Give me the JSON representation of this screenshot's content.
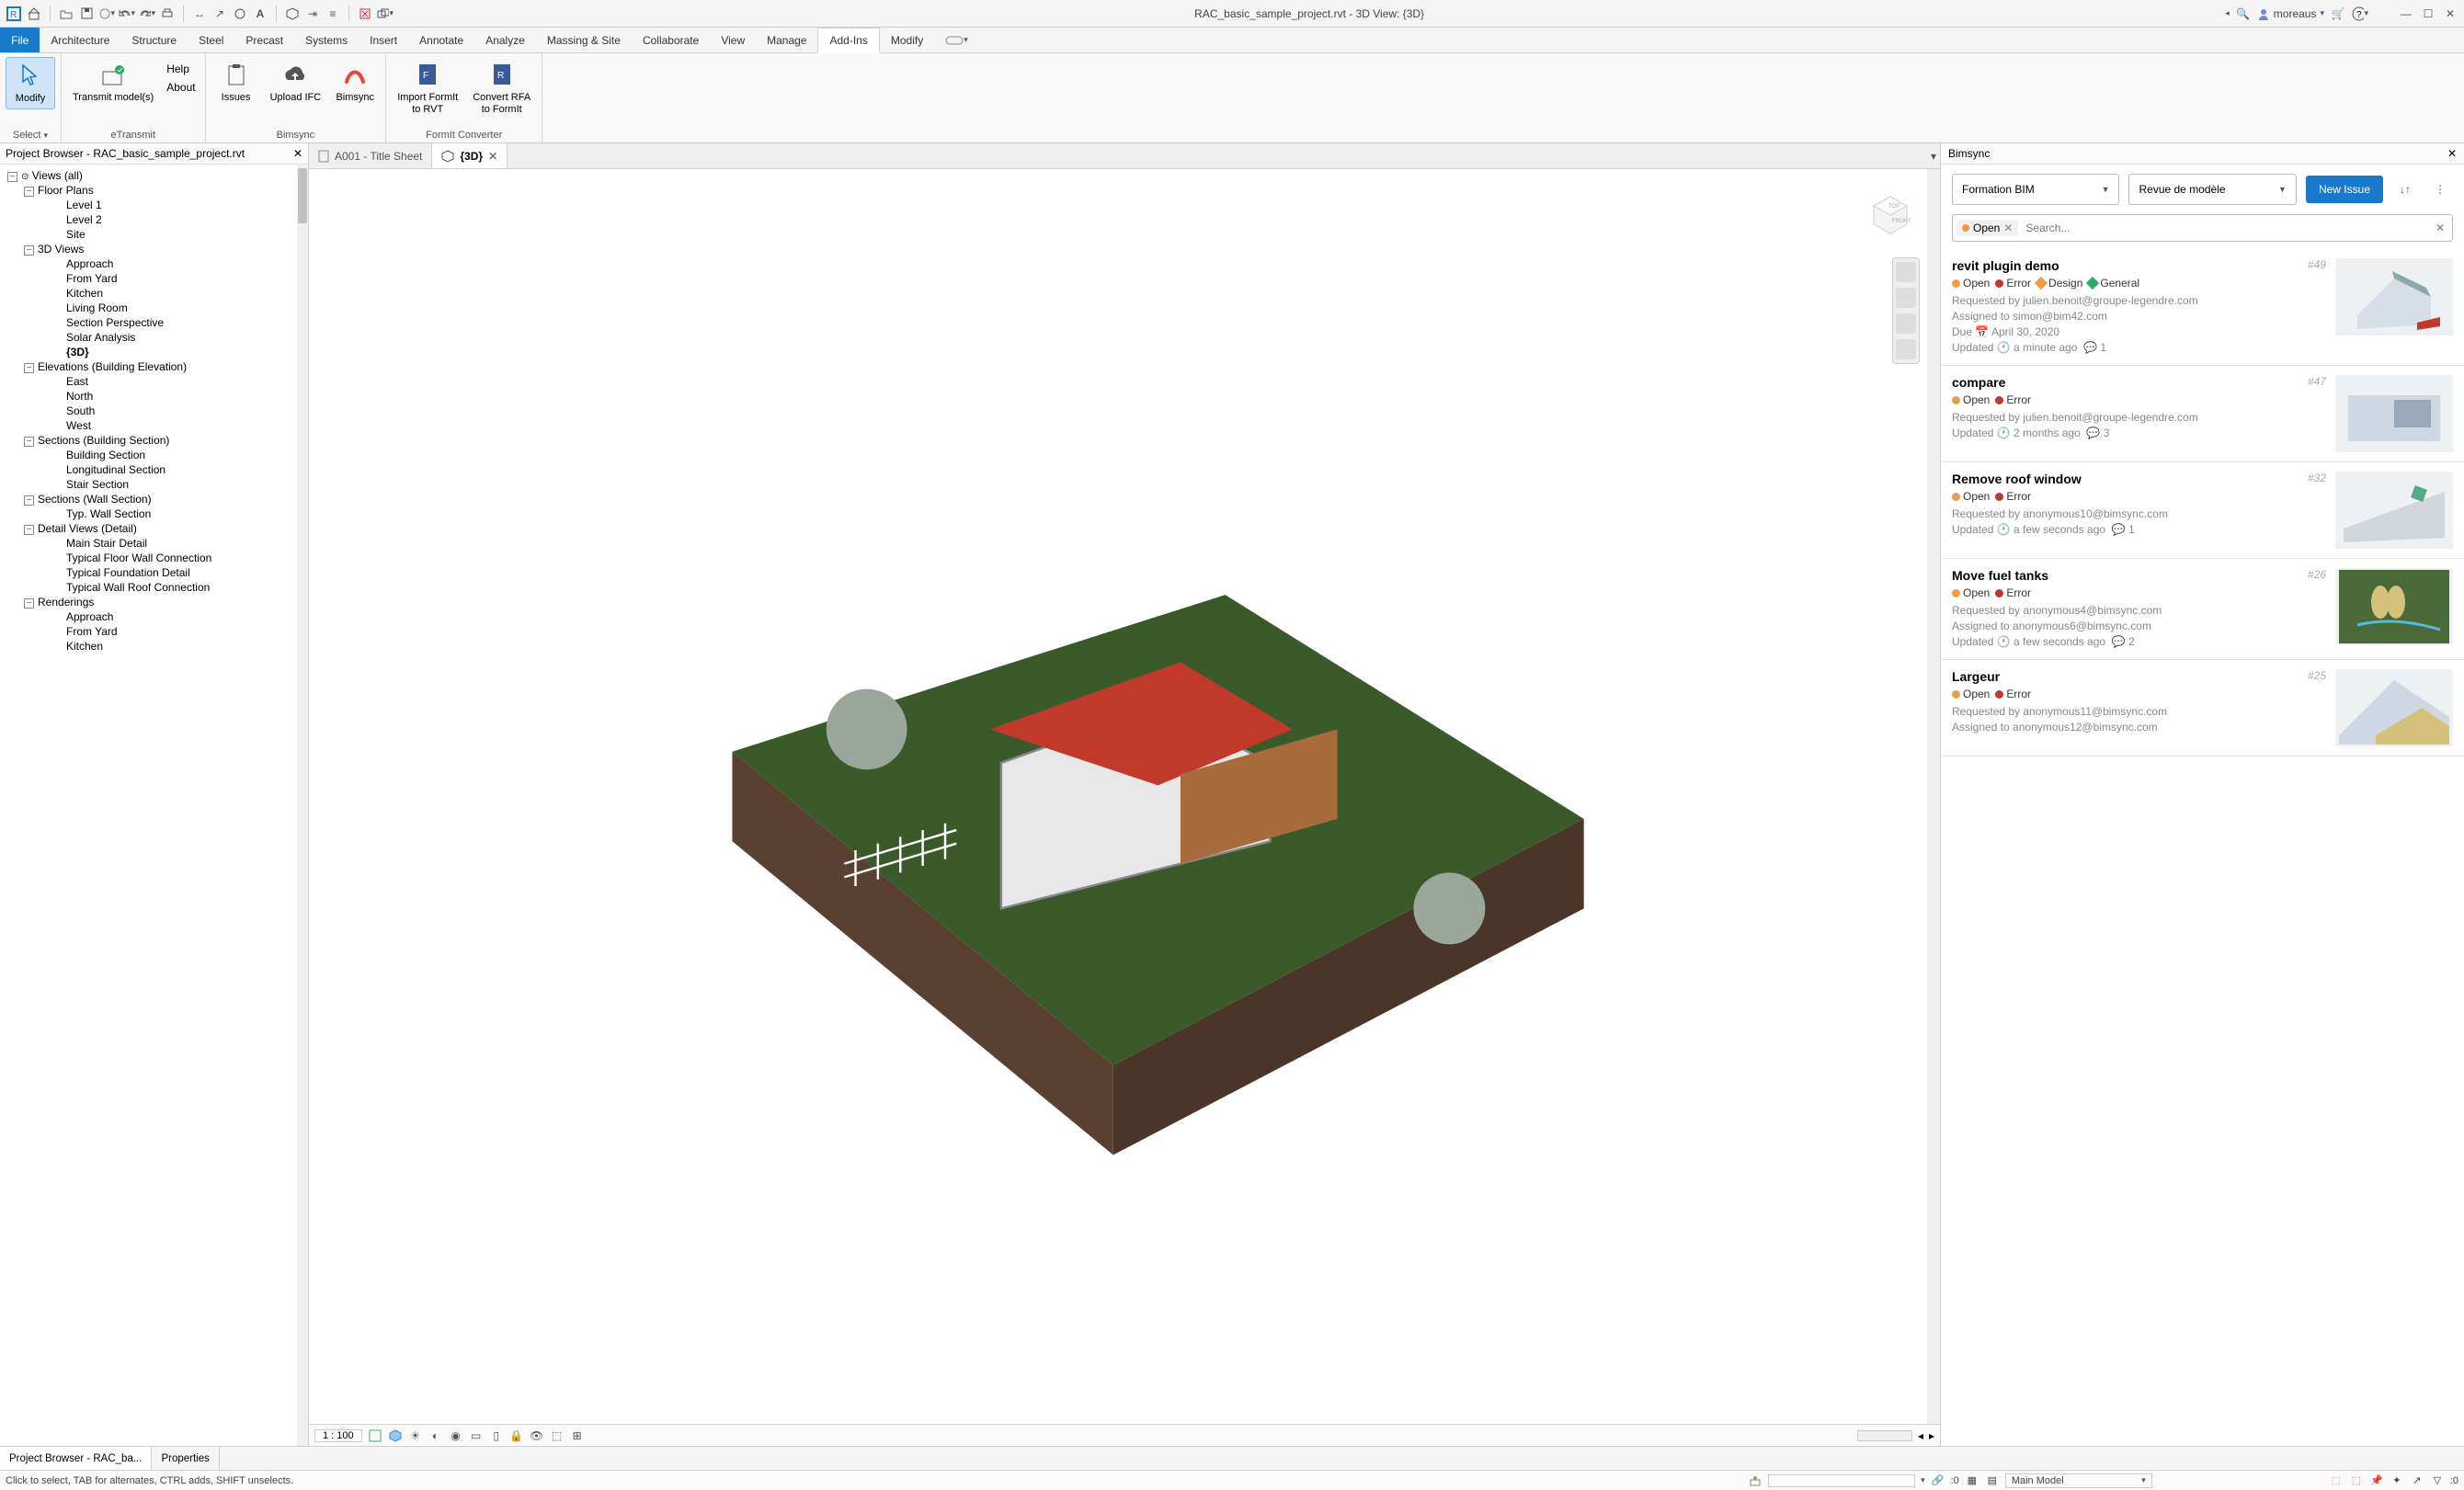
{
  "titlebar": {
    "title": "RAC_basic_sample_project.rvt - 3D View: {3D}",
    "user": "moreaus"
  },
  "menu": {
    "file": "File",
    "tabs": [
      "Architecture",
      "Structure",
      "Steel",
      "Precast",
      "Systems",
      "Insert",
      "Annotate",
      "Analyze",
      "Massing & Site",
      "Collaborate",
      "View",
      "Manage",
      "Add-Ins",
      "Modify"
    ],
    "active": "Add-Ins"
  },
  "ribbon": {
    "modify": {
      "label": "Modify",
      "group": "Select"
    },
    "etransmit": {
      "help": "Help",
      "about": "About",
      "transmit": "Transmit model(s)",
      "group": "eTransmit"
    },
    "bimsync": {
      "issues": "Issues",
      "upload": "Upload IFC",
      "bimsync": "Bimsync",
      "group": "Bimsync"
    },
    "formit": {
      "import": "Import FormIt\nto RVT",
      "convert": "Convert RFA\nto FormIt",
      "group": "FormIt Converter"
    }
  },
  "projectBrowser": {
    "title": "Project Browser - RAC_basic_sample_project.rvt",
    "root": "Views (all)",
    "floorPlans": {
      "label": "Floor Plans",
      "items": [
        "Level 1",
        "Level 2",
        "Site"
      ]
    },
    "views3d": {
      "label": "3D Views",
      "items": [
        "Approach",
        "From Yard",
        "Kitchen",
        "Living Room",
        "Section Perspective",
        "Solar Analysis",
        "{3D}"
      ]
    },
    "elevations": {
      "label": "Elevations (Building Elevation)",
      "items": [
        "East",
        "North",
        "South",
        "West"
      ]
    },
    "sectionsB": {
      "label": "Sections (Building Section)",
      "items": [
        "Building Section",
        "Longitudinal Section",
        "Stair Section"
      ]
    },
    "sectionsW": {
      "label": "Sections (Wall Section)",
      "items": [
        "Typ. Wall Section"
      ]
    },
    "detail": {
      "label": "Detail Views (Detail)",
      "items": [
        "Main Stair Detail",
        "Typical Floor Wall Connection",
        "Typical Foundation Detail",
        "Typical Wall Roof Connection"
      ]
    },
    "renderings": {
      "label": "Renderings",
      "items": [
        "Approach",
        "From Yard",
        "Kitchen"
      ]
    }
  },
  "docTabs": {
    "tab1": "A001 - Title Sheet",
    "tab2": "{3D}"
  },
  "viewbar": {
    "scale": "1 : 100"
  },
  "bimsync": {
    "panelTitle": "Bimsync",
    "dd1": "Formation BIM",
    "dd2": "Revue de modèle",
    "newIssue": "New Issue",
    "searchPlaceholder": "Search...",
    "openChip": "Open",
    "issues": [
      {
        "title": "revit plugin demo",
        "num": "#49",
        "status": "Open",
        "type": "Error",
        "labels": [
          {
            "text": "Design",
            "color": "#f2994a"
          },
          {
            "text": "General",
            "color": "#27ae60"
          }
        ],
        "requested": "Requested by julien.benoit@groupe-legendre.com",
        "assigned": "Assigned to simon@bim42.com",
        "due": "Due",
        "dueDate": "April 30, 2020",
        "updated": "Updated",
        "updatedTime": "a minute ago",
        "comments": "1"
      },
      {
        "title": "compare",
        "num": "#47",
        "status": "Open",
        "type": "Error",
        "labels": [],
        "requested": "Requested by julien.benoit@groupe-legendre.com",
        "updated": "Updated",
        "updatedTime": "2 months ago",
        "comments": "3"
      },
      {
        "title": "Remove roof window",
        "num": "#32",
        "status": "Open",
        "type": "Error",
        "labels": [],
        "requested": "Requested by anonymous10@bimsync.com",
        "updated": "Updated",
        "updatedTime": "a few seconds ago",
        "comments": "1"
      },
      {
        "title": "Move fuel tanks",
        "num": "#26",
        "status": "Open",
        "type": "Error",
        "labels": [],
        "requested": "Requested by anonymous4@bimsync.com",
        "assigned": "Assigned to anonymous6@bimsync.com",
        "updated": "Updated",
        "updatedTime": "a few seconds ago",
        "comments": "2"
      },
      {
        "title": "Largeur",
        "num": "#25",
        "status": "Open",
        "type": "Error",
        "labels": [],
        "requested": "Requested by anonymous11@bimsync.com",
        "assigned": "Assigned to anonymous12@bimsync.com"
      }
    ]
  },
  "bottomTabs": {
    "t1": "Project Browser - RAC_ba...",
    "t2": "Properties"
  },
  "status": {
    "hint": "Click to select, TAB for alternates, CTRL adds, SHIFT unselects.",
    "zero": ":0",
    "mainModel": "Main Model"
  }
}
